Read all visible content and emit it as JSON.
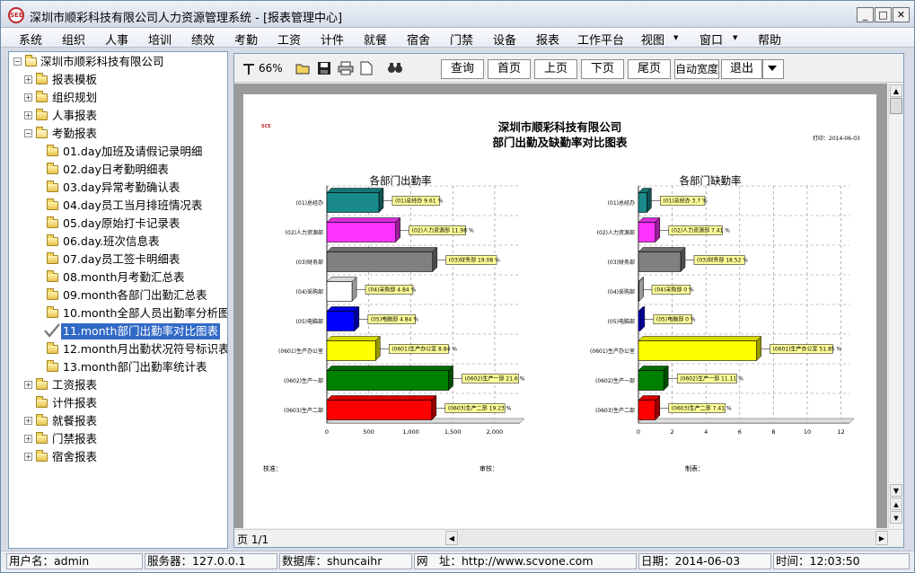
{
  "window": {
    "title": "深圳市顺彩科技有限公司人力资源管理系统 - [报表管理中心]",
    "icon_text": "SEE",
    "btn_min": "_",
    "btn_max": "□",
    "btn_close": "✕"
  },
  "menu": [
    "系统",
    "组织",
    "人事",
    "培训",
    "绩效",
    "考勤",
    "工资",
    "计件",
    "就餐",
    "宿舍",
    "门禁",
    "设备",
    "报表",
    "工作平台",
    "视图",
    "窗口",
    "帮助"
  ],
  "menu_arrow": "▼",
  "tree": {
    "root": "深圳市顺彩科技有限公司",
    "folders": [
      "报表模板",
      "组织规划",
      "人事报表",
      "考勤报表"
    ],
    "attendance": [
      "01.day加班及请假记录明细",
      "02.day日考勤明细表",
      "03.day异常考勤确认表",
      "04.day员工当月排班情况表",
      "05.day原始打卡记录表",
      "06.day.班次信息表",
      "07.day员工签卡明细表",
      "08.month月考勤汇总表",
      "09.month各部门出勤汇总表",
      "10.month全部人员出勤率分析图表",
      "11.month部门出勤率对比图表",
      "12.month月出勤状况符号标识表",
      "13.month部门出勤率统计表"
    ],
    "after": [
      "工资报表",
      "计件报表",
      "就餐报表",
      "门禁报表",
      "宿舍报表"
    ]
  },
  "toolbar": {
    "zoom": "66%",
    "query": "查询",
    "first": "首页",
    "prev": "上页",
    "next": "下页",
    "last": "尾页",
    "autowidth": "自动宽度",
    "exit": "退出",
    "combo": ""
  },
  "report": {
    "logo": "SCE",
    "title1": "深圳市顺彩科技有限公司",
    "title2": "部门出勤及缺勤率对比图表",
    "print_date": "打印：2014-06-03",
    "sig_make": "制表：",
    "sig_review": "审核：",
    "sig_approve": "核准："
  },
  "chart_data": [
    {
      "type": "bar",
      "orientation": "horizontal",
      "title": "各部门出勤率",
      "categories": [
        "(01)总经办",
        "(02)人力资源部",
        "(03)财务部",
        "(04)采购部",
        "(05)电脑部",
        "(0601)生产办公室",
        "(0602)生产一部",
        "(0603)生产二部"
      ],
      "values": [
        620,
        820,
        1260,
        300,
        330,
        580,
        1450,
        1250
      ],
      "data_labels": [
        "(01)总经办 9.61 %",
        "(02)人力资源部 11.98 %",
        "(03)财务部 19.08 %",
        "(04)采购部 4.84 %",
        "(05)电脑部 4.84 %",
        "(0601)生产办公室 8.84 %",
        "(0602)生产一部 21.6 %",
        "(0603)生产二部 19.23 %"
      ],
      "colors": [
        "#1a8a8a",
        "#ff33ff",
        "#808080",
        "#ffffff",
        "#0000ff",
        "#ffff00",
        "#008000",
        "#ff0000"
      ],
      "xticks": [
        "0",
        "500",
        "1,000",
        "1,500",
        "2,000"
      ],
      "xlim": [
        0,
        2300
      ]
    },
    {
      "type": "bar",
      "orientation": "horizontal",
      "title": "各部门缺勤率",
      "categories": [
        "(01)总经办",
        "(02)人力资源部",
        "(03)财务部",
        "(04)采购部",
        "(05)电脑部",
        "(0601)生产办公室",
        "(0602)生产一部",
        "(0603)生产二部"
      ],
      "values": [
        0.5,
        1,
        2.5,
        0,
        0.1,
        7,
        1.5,
        1
      ],
      "data_labels": [
        "(01)总经办 3.7 %",
        "(02)人力资源部 7.41 %",
        "(03)财务部 18.52 %",
        "(04)采购部 0 %",
        "(05)电脑部 0 %",
        "(0601)生产办公室 51.85 %",
        "(0602)生产一部 11.11 %",
        "(0603)生产二部 7.41 %"
      ],
      "colors": [
        "#1a8a8a",
        "#ff33ff",
        "#808080",
        "#ffffff",
        "#0000ff",
        "#ffff00",
        "#008000",
        "#ff0000"
      ],
      "xticks": [
        "0",
        "2",
        "4",
        "6",
        "8",
        "10",
        "12"
      ],
      "xlim": [
        0,
        12.5
      ]
    }
  ],
  "pager": {
    "page": "页 1/1"
  },
  "status": {
    "user": "用户名：admin",
    "server": "服务器：127.0.0.1",
    "db": "数据库：shuncaihr",
    "web": "网　址：http://www.scvone.com",
    "date": "日期：2014-06-03",
    "time": "时间：12:03:50"
  }
}
